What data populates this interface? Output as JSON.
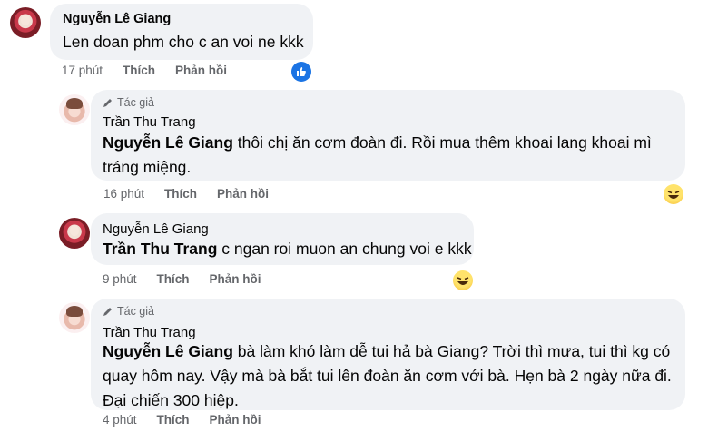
{
  "comments": [
    {
      "author": "Nguyễn Lê Giang",
      "text": "Len doan phm cho c an voi ne kkk",
      "time": "17 phút",
      "like": "Thích",
      "reply": "Phản hồi",
      "reaction": "like-icon"
    },
    {
      "badge": "Tác giả",
      "author": "Trần Thu Trang",
      "mention": "Nguyễn Lê Giang",
      "text_line1": "thôi chị ăn cơm đoàn đi. Rồi mua thêm khoai lang khoai mì",
      "text_line2": "tráng miệng.",
      "time": "16 phút",
      "like": "Thích",
      "reply": "Phản hồi",
      "reaction": "haha-icon"
    },
    {
      "author": "Nguyễn Lê Giang",
      "mention": "Trần Thu Trang",
      "text": "c ngan roi muon an chung voi e kkk",
      "time": "9 phút",
      "like": "Thích",
      "reply": "Phản hồi",
      "reaction": "haha-icon"
    },
    {
      "badge": "Tác giả",
      "author": "Trần Thu Trang",
      "mention": "Nguyễn Lê Giang",
      "text_line1": "bà làm khó làm dễ tui hả bà Giang? Trời thì mưa, tui thì kg có",
      "text_line2": "quay hôm nay. Vậy mà bà bắt tui lên đoàn ăn cơm với bà. Hẹn bà 2 ngày nữa đi.",
      "text_line3": "Đại chiến 300 hiệp.",
      "time": "4 phút",
      "like": "Thích",
      "reply": "Phản hồi"
    }
  ],
  "colors": {
    "bubble": "#f0f2f5",
    "meta": "#65676b",
    "like_blue": "#1b74e4"
  }
}
